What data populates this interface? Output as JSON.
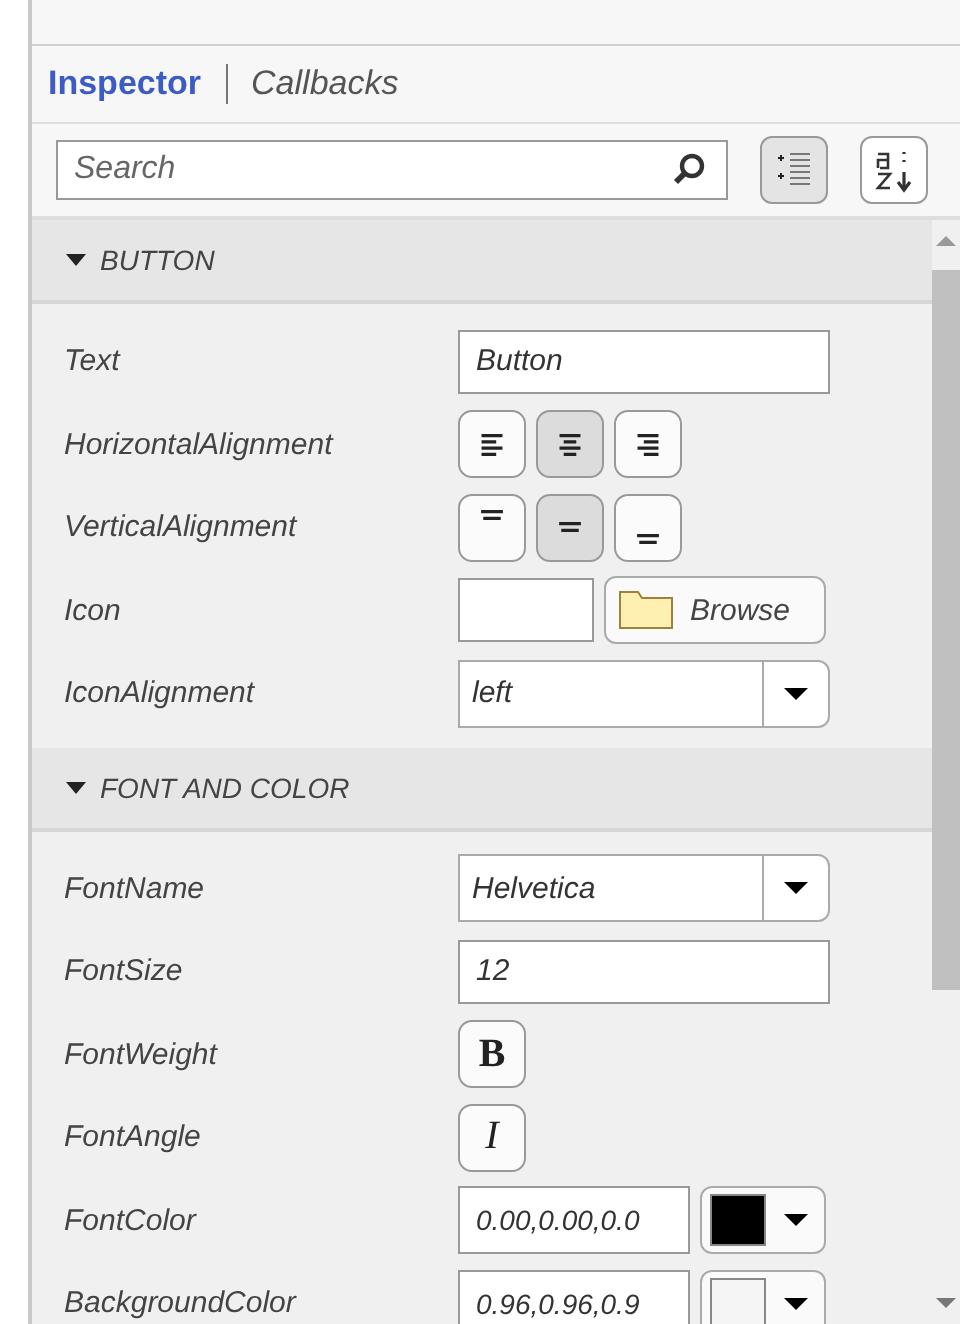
{
  "tabs": [
    {
      "label": "Inspector",
      "selected": true
    },
    {
      "label": "Callbacks",
      "selected": false
    }
  ],
  "search": {
    "placeholder": "Search"
  },
  "view_buttons": [
    {
      "kind": "grouped",
      "selected": true
    },
    {
      "kind": "alphabetical",
      "selected": false
    }
  ],
  "sections": [
    {
      "title": "BUTTON",
      "expanded": true,
      "properties": [
        {
          "kind": "text",
          "label": "Text",
          "value": "Button"
        },
        {
          "kind": "segmented",
          "label": "HorizontalAlignment",
          "options": [
            {
              "kind": "left",
              "selected": false
            },
            {
              "kind": "center",
              "selected": true
            },
            {
              "kind": "right",
              "selected": false
            }
          ]
        },
        {
          "kind": "segmented",
          "label": "VerticalAlignment",
          "options": [
            {
              "kind": "top",
              "selected": false
            },
            {
              "kind": "middle",
              "selected": true
            },
            {
              "kind": "bottom",
              "selected": false
            }
          ]
        },
        {
          "kind": "file",
          "label": "Icon",
          "button": "Browse"
        },
        {
          "kind": "dropdown",
          "label": "IconAlignment",
          "value": "left"
        }
      ]
    },
    {
      "title": "FONT AND COLOR",
      "expanded": true,
      "properties": [
        {
          "kind": "dropdown",
          "label": "FontName",
          "value": "Helvetica"
        },
        {
          "kind": "text",
          "label": "FontSize",
          "value": "12"
        },
        {
          "kind": "bold",
          "label": "FontWeight",
          "glyph": "B",
          "selected": false
        },
        {
          "kind": "italic",
          "label": "FontAngle",
          "glyph": "I",
          "selected": false
        },
        {
          "kind": "color",
          "label": "FontColor",
          "value": "0.00,0.00,0.0",
          "color": "#000000"
        },
        {
          "kind": "color",
          "label": "BackgroundColor",
          "value": "0.96,0.96,0.9",
          "color": "#f5f5f5"
        }
      ]
    }
  ]
}
